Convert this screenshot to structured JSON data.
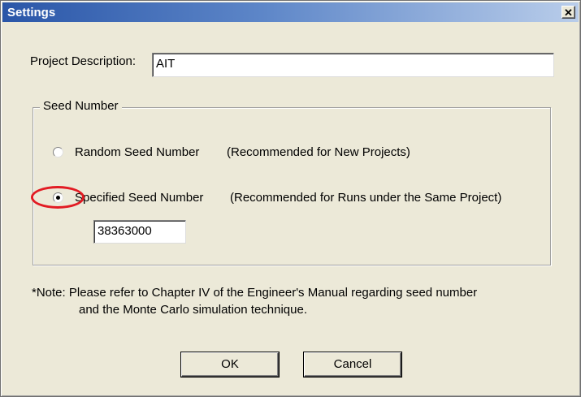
{
  "window": {
    "title": "Settings",
    "close_glyph": "✕"
  },
  "project": {
    "label": "Project Description:",
    "value": "AIT"
  },
  "seed_group": {
    "legend": "Seed Number",
    "options": [
      {
        "label": "Random Seed Number",
        "hint": "(Recommended for New Projects)",
        "selected": false
      },
      {
        "label": "Specified Seed Number",
        "hint": "(Recommended for Runs under the Same Project)",
        "selected": true
      }
    ],
    "seed_value": "38363000"
  },
  "note": {
    "line1": "*Note:  Please refer to Chapter IV of the Engineer's Manual regarding seed number",
    "line2": "and the Monte Carlo simulation technique."
  },
  "buttons": {
    "ok": "OK",
    "cancel": "Cancel"
  },
  "colors": {
    "annotation_ring": "#e21b23",
    "titlebar": "#2a56a8"
  }
}
